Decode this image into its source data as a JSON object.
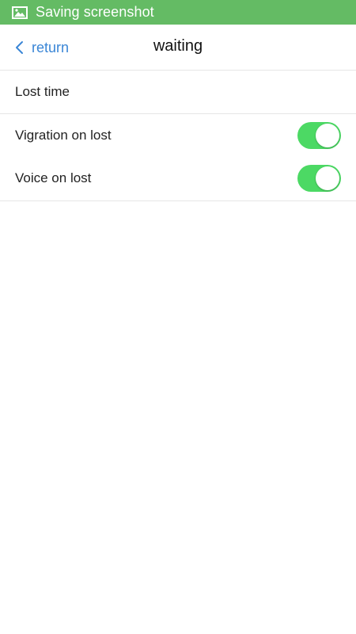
{
  "status_bar": {
    "icon": "image-icon",
    "text": "Saving screenshot",
    "color": "#64bb64"
  },
  "nav": {
    "back_label": "return",
    "back_icon": "chevron-left-icon",
    "title": "waiting",
    "accent_color": "#3a86d6"
  },
  "settings": {
    "lost_time_label": "Lost time",
    "vibration_label": "Vigration on lost",
    "vibration_enabled": true,
    "voice_label": "Voice on lost",
    "voice_enabled": true,
    "toggle_on_color": "#4cd964"
  }
}
